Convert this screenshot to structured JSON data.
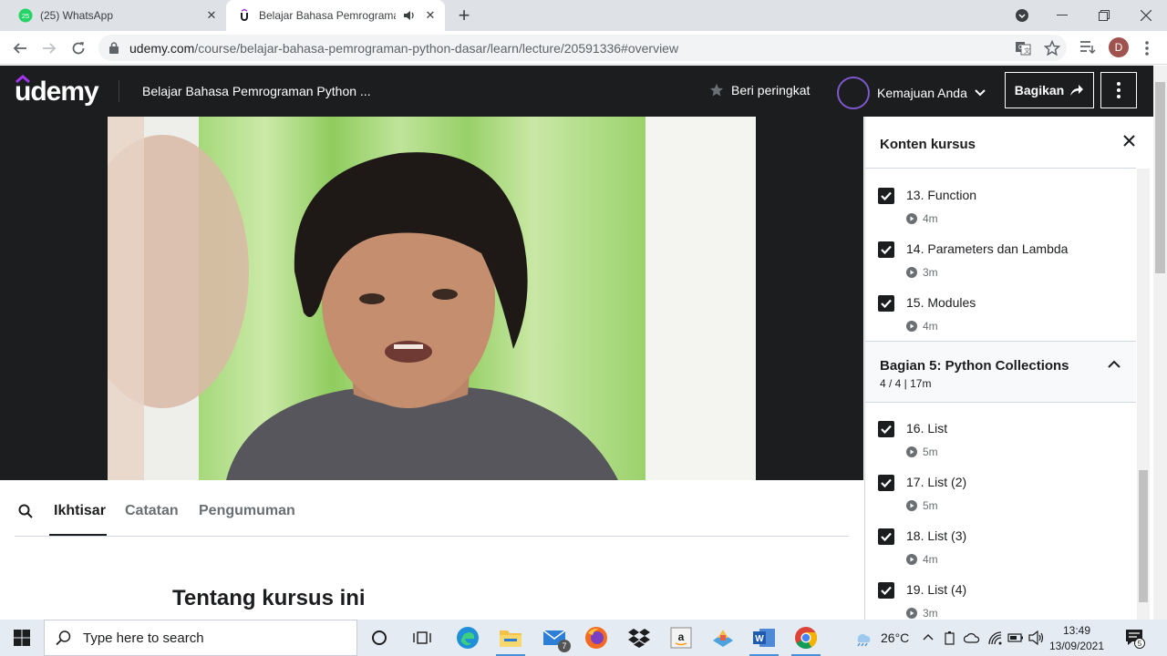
{
  "browser": {
    "tabs": [
      {
        "title": "(25) WhatsApp",
        "badge": "25",
        "active": false
      },
      {
        "title": "Belajar Bahasa Pemrograman",
        "active": true
      }
    ],
    "url_host": "udemy.com",
    "url_path": "/course/belajar-bahasa-pemrograman-python-dasar/learn/lecture/20591336#overview",
    "profile_initial": "D"
  },
  "header": {
    "logo": "udemy",
    "course_title": "Belajar Bahasa Pemrograman Python ...",
    "rate_label": "Beri peringkat",
    "progress_label": "Kemajuan Anda",
    "share_label": "Bagikan"
  },
  "subtabs": [
    {
      "label": "Ikhtisar",
      "active": true
    },
    {
      "label": "Catatan",
      "active": false
    },
    {
      "label": "Pengumuman",
      "active": false
    }
  ],
  "about_heading": "Tentang kursus ini",
  "sidebar": {
    "title": "Konten kursus",
    "lessons_top": [
      {
        "title": "13. Function",
        "duration": "4m",
        "done": true
      },
      {
        "title": "14. Parameters dan Lambda",
        "duration": "3m",
        "done": true
      },
      {
        "title": "15. Modules",
        "duration": "4m",
        "done": true
      }
    ],
    "section": {
      "title": "Bagian 5: Python Collections",
      "subtitle": "4 / 4 | 17m"
    },
    "lessons_bottom": [
      {
        "title": "16. List",
        "duration": "5m",
        "done": true
      },
      {
        "title": "17. List (2)",
        "duration": "5m",
        "done": true
      },
      {
        "title": "18. List (3)",
        "duration": "4m",
        "done": true
      },
      {
        "title": "19. List (4)",
        "duration": "3m",
        "done": true
      }
    ]
  },
  "taskbar": {
    "search_placeholder": "Type here to search",
    "mail_badge": "7",
    "weather": "26°C",
    "time": "13:49",
    "date": "13/09/2021",
    "notifications": "5"
  },
  "colors": {
    "udemy_dark": "#1c1d1f",
    "udemy_purple": "#a435f0",
    "progress_ring": "#7e59ce",
    "tab_strip": "#dee1e6"
  }
}
